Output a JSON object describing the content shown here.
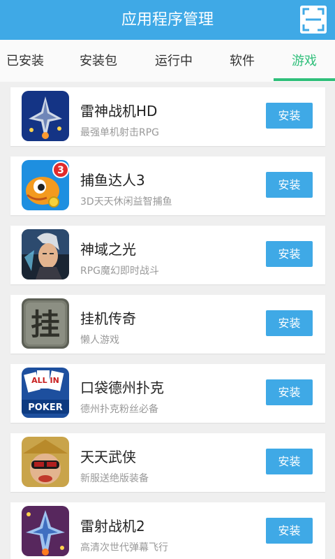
{
  "header": {
    "title": "应用程序管理",
    "scan_icon": "scan-frame-icon"
  },
  "tabs": [
    {
      "label": "已安装",
      "active": false
    },
    {
      "label": "安装包",
      "active": false
    },
    {
      "label": "运行中",
      "active": false
    },
    {
      "label": "软件",
      "active": false
    },
    {
      "label": "游戏",
      "active": true
    }
  ],
  "colors": {
    "primary": "#3fa9e6",
    "active_tab": "#2fbf7a",
    "background": "#efefef"
  },
  "apps": [
    {
      "name": "雷神战机HD",
      "description": "最强单机射击RPG",
      "button": "安装",
      "icon": "space-fighter-icon"
    },
    {
      "name": "捕鱼达人3",
      "description": "3D天天休闲益智捕鱼",
      "button": "安装",
      "icon": "cartoon-fish-icon",
      "icon_badge": "3"
    },
    {
      "name": "神域之光",
      "description": "RPG魔幻即时战斗",
      "button": "安装",
      "icon": "warrior-portrait-icon"
    },
    {
      "name": "挂机传奇",
      "description": "懒人游戏",
      "button": "安装",
      "icon": "stone-glyph-icon",
      "icon_text": "挂"
    },
    {
      "name": "口袋德州扑克",
      "description": "德州扑克粉丝必备",
      "button": "安装",
      "icon": "poker-cards-icon",
      "icon_text": "ALL IN",
      "icon_caption": "POKER"
    },
    {
      "name": "天天武侠",
      "description": "新服送绝版装备",
      "button": "安装",
      "icon": "hero-cartoon-icon"
    },
    {
      "name": "雷射战机2",
      "description": "高清次世代弹幕飞行",
      "button": "安装",
      "icon": "laser-jet-icon"
    }
  ]
}
